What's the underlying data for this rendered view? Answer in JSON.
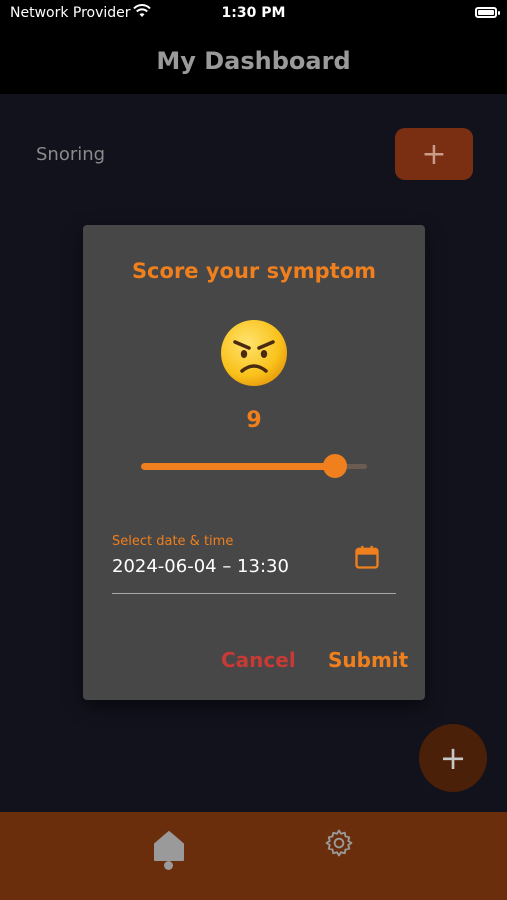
{
  "status_bar": {
    "carrier": "Network Provider",
    "time": "1:30 PM",
    "wifi_icon": "wifi-icon",
    "battery_icon": "battery-icon"
  },
  "header": {
    "title": "My Dashboard"
  },
  "dashboard": {
    "symptom_label": "Snoring",
    "symptom_add_label": "+",
    "fab_label": "+"
  },
  "dialog": {
    "title": "Score your symptom",
    "emoji": "angry-face-emoji",
    "score": "9",
    "slider": {
      "value": 9,
      "min": 0,
      "max": 10
    },
    "date_field": {
      "label": "Select date & time",
      "value": "2024-06-04 – 13:30",
      "icon": "calendar-icon"
    },
    "cancel_label": "Cancel",
    "submit_label": "Submit"
  },
  "bottom_nav": {
    "items": [
      {
        "name": "home",
        "icon": "home-icon",
        "active": true
      },
      {
        "name": "settings",
        "icon": "gear-icon",
        "active": false
      }
    ]
  },
  "colors": {
    "accent": "#f07f1e",
    "cancel": "#c73a36",
    "background": "#11121c",
    "header_bg": "#000000",
    "dialog_bg": "#474747",
    "nav_bg": "#6b2e0c"
  }
}
